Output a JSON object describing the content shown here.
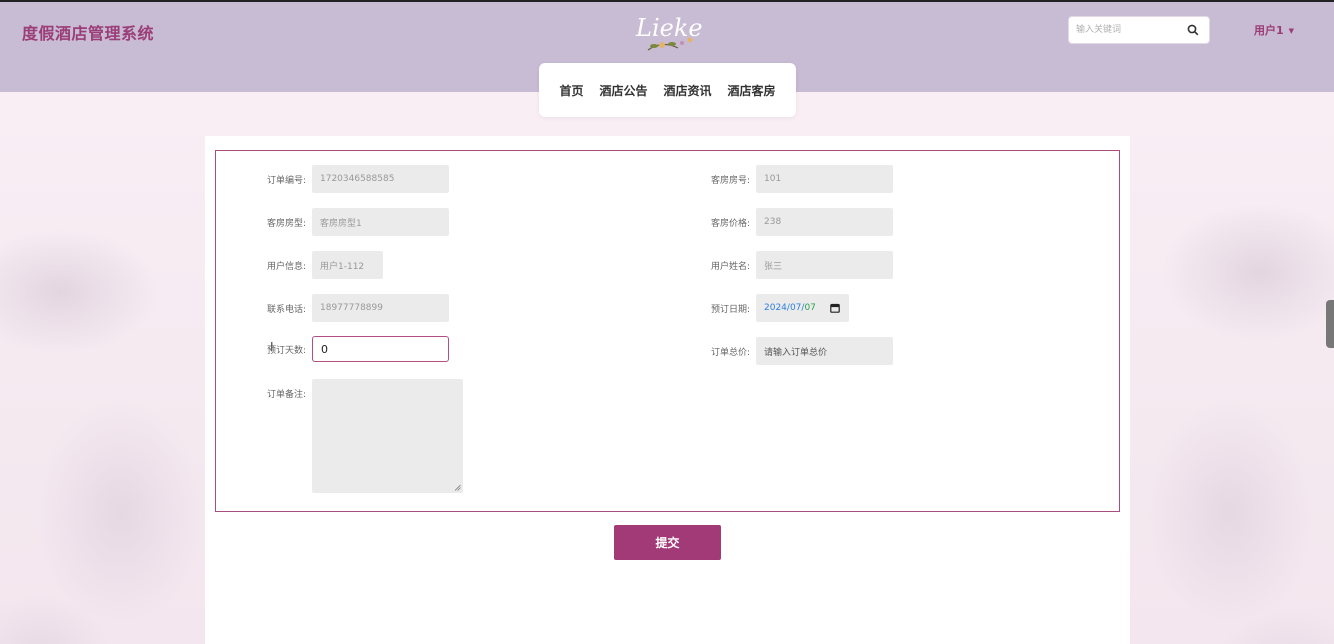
{
  "header": {
    "brand": "度假酒店管理系统",
    "logo_text": "Lieke",
    "search_placeholder": "输入关键词",
    "user_label": "用户1"
  },
  "nav": {
    "items": [
      {
        "label": "首页"
      },
      {
        "label": "酒店公告"
      },
      {
        "label": "酒店资讯"
      },
      {
        "label": "酒店客房"
      }
    ]
  },
  "form": {
    "order_no": {
      "label": "订单编号:",
      "value": "1720346588585"
    },
    "room_no": {
      "label": "客房房号:",
      "value": "101"
    },
    "room_type": {
      "label": "客房房型:",
      "value": "客房房型1"
    },
    "room_price": {
      "label": "客房价格:",
      "value": "238"
    },
    "user_info": {
      "label": "用户信息:",
      "value": "用户1-112"
    },
    "user_name": {
      "label": "用户姓名:",
      "value": "张三"
    },
    "phone": {
      "label": "联系电话:",
      "value": "18977778899"
    },
    "book_date": {
      "label": "预订日期:",
      "year": "2024",
      "month": "07",
      "day": "07",
      "sep": "/"
    },
    "book_days": {
      "label": "预订天数:",
      "value": "0"
    },
    "order_total": {
      "label": "订单总价:",
      "placeholder": "请输入订单总价"
    },
    "order_note": {
      "label": "订单备注:"
    }
  },
  "submit_label": "提交",
  "colors": {
    "brand": "#9b3d78",
    "header_bg": "#c8bbd4",
    "accent": "#a23a78",
    "border": "#a84d80"
  }
}
